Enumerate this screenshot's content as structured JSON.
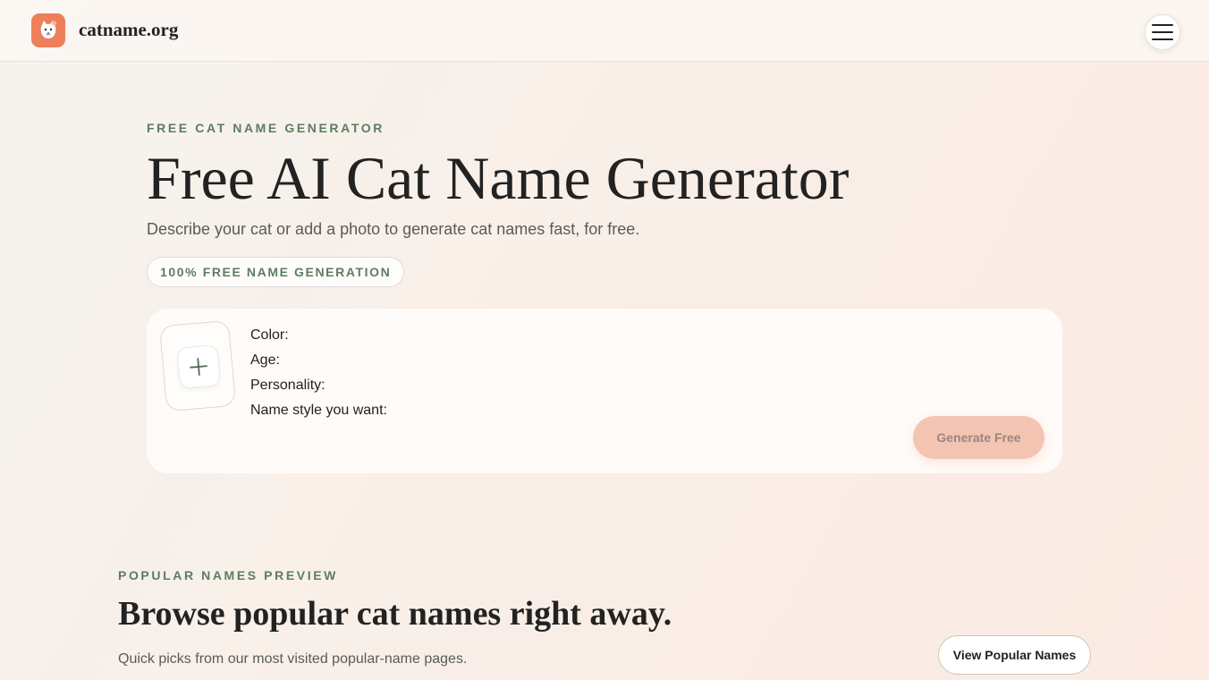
{
  "header": {
    "brand": "catname.org",
    "logo_icon": "cat-face-icon",
    "menu_icon": "hamburger-menu-icon"
  },
  "hero": {
    "eyebrow": "FREE CAT NAME GENERATOR",
    "title": "Free AI Cat Name Generator",
    "subtitle": "Describe your cat or add a photo to generate cat names fast, for free.",
    "badge": "100% FREE NAME GENERATION"
  },
  "form": {
    "upload_icon": "plus-icon",
    "fields": [
      "Color:",
      "Age:",
      "Personality:",
      "Name style you want:"
    ],
    "submit_label": "Generate Free"
  },
  "popular": {
    "eyebrow": "POPULAR NAMES PREVIEW",
    "title": "Browse popular cat names right away.",
    "subtitle": "Quick picks from our most visited popular-name pages.",
    "button_label": "View Popular Names"
  },
  "colors": {
    "accent": "#ee7f5a",
    "eyebrow_green": "#5d7d5e",
    "button_disabled": "#f4c4b2"
  }
}
